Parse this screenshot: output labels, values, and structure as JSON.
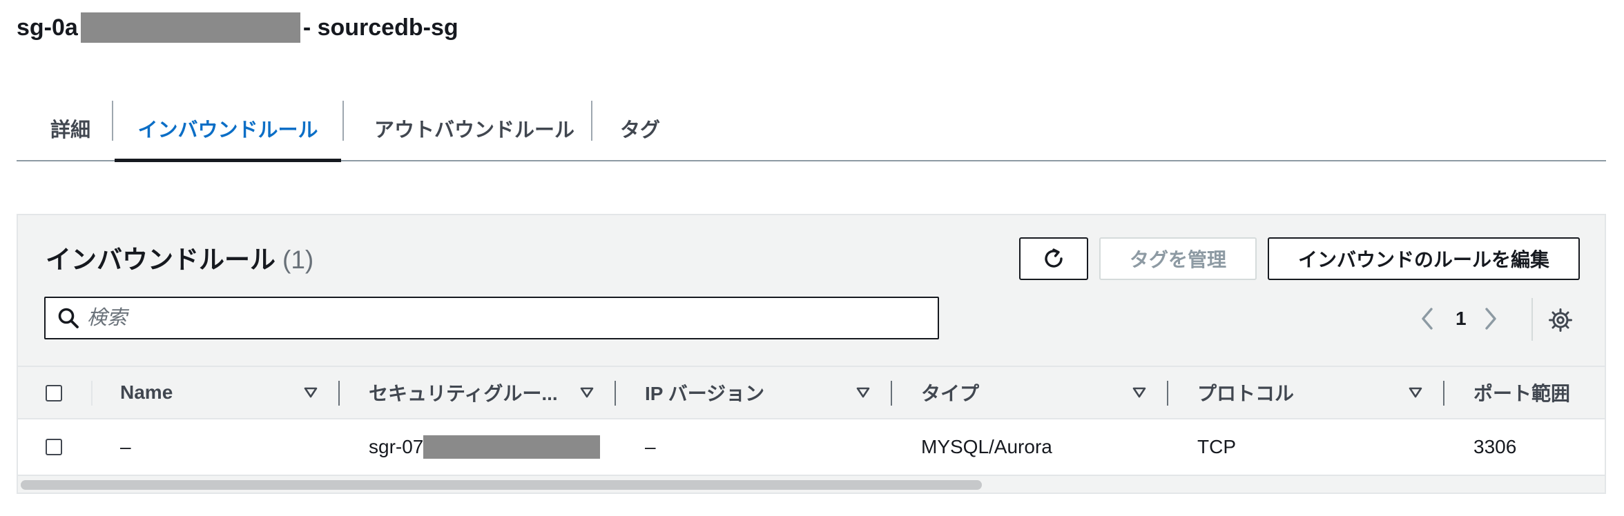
{
  "header": {
    "id_prefix": "sg-0a",
    "title_suffix": "- sourcedb-sg"
  },
  "tabs": [
    {
      "label": "詳細",
      "active": false
    },
    {
      "label": "インバウンドルール",
      "active": true
    },
    {
      "label": "アウトバウンドルール",
      "active": false
    },
    {
      "label": "タグ",
      "active": false
    }
  ],
  "panel": {
    "title": "インバウンドルール",
    "count": "(1)",
    "buttons": {
      "refresh_icon": "refresh-icon",
      "manage_tags": "タグを管理",
      "edit_inbound": "インバウンドのルールを編集"
    },
    "search": {
      "placeholder": "検索",
      "value": ""
    },
    "pagination": {
      "page": "1"
    }
  },
  "table": {
    "columns": [
      "Name",
      "セキュリティグルー...",
      "IP バージョン",
      "タイプ",
      "プロトコル",
      "ポート範囲"
    ],
    "rows": [
      {
        "name": "–",
        "sgr_prefix": "sgr-07",
        "ip_version": "–",
        "type": "MYSQL/Aurora",
        "protocol": "TCP",
        "port_range": "3306"
      }
    ]
  },
  "colors": {
    "accent": "#0b6ec6",
    "text": "#16191f",
    "muted": "#687078",
    "panel_bg": "#f2f3f3"
  }
}
